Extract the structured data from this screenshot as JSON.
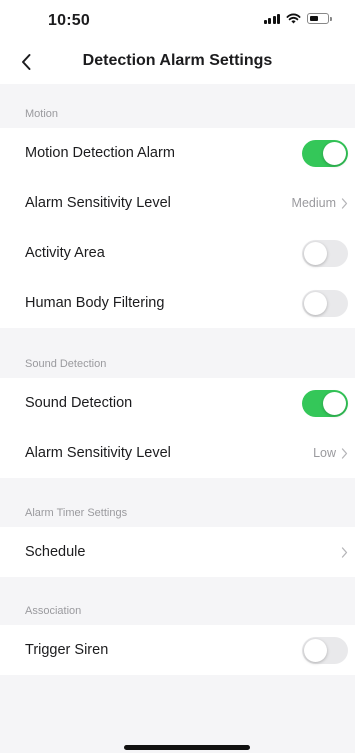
{
  "status_bar": {
    "time": "10:50"
  },
  "nav": {
    "title": "Detection Alarm Settings"
  },
  "sections": [
    {
      "header": "Motion",
      "rows": [
        {
          "label": "Motion Detection Alarm",
          "type": "toggle",
          "on": true
        },
        {
          "label": "Alarm Sensitivity Level",
          "type": "value",
          "value": "Medium"
        },
        {
          "label": "Activity Area",
          "type": "toggle",
          "on": false
        },
        {
          "label": "Human Body Filtering",
          "type": "toggle",
          "on": false
        }
      ]
    },
    {
      "header": "Sound Detection",
      "rows": [
        {
          "label": "Sound Detection",
          "type": "toggle",
          "on": true
        },
        {
          "label": "Alarm Sensitivity Level",
          "type": "value",
          "value": "Low"
        }
      ]
    },
    {
      "header": "Alarm Timer Settings",
      "rows": [
        {
          "label": "Schedule",
          "type": "value",
          "value": ""
        }
      ]
    },
    {
      "header": "Association",
      "rows": [
        {
          "label": "Trigger Siren",
          "type": "toggle",
          "on": false
        }
      ]
    }
  ],
  "colors": {
    "toggle_on": "#34c759",
    "toggle_off": "#e9e9eb",
    "background": "#f5f5f7"
  },
  "icons": {
    "back": "chevron-left-icon",
    "row_arrow": "chevron-right-icon"
  }
}
